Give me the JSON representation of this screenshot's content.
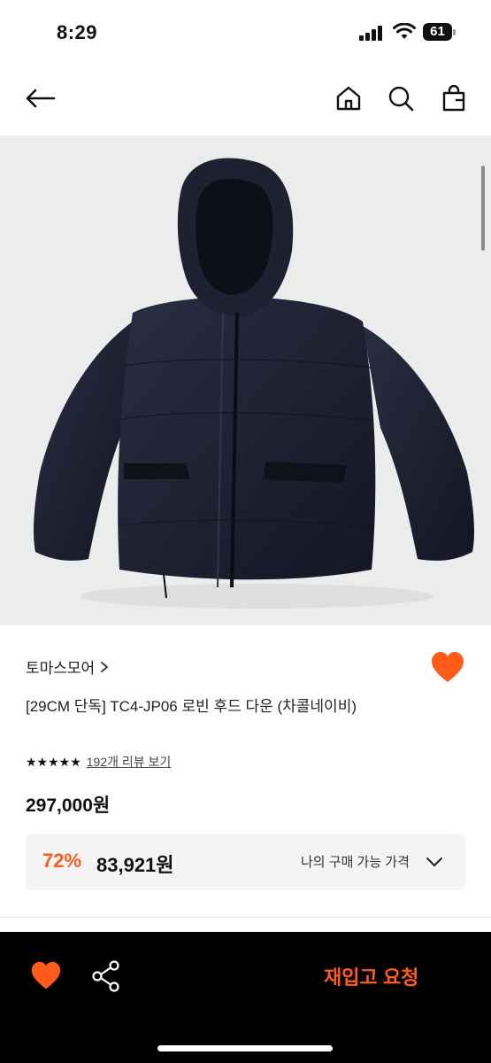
{
  "status_bar": {
    "time": "8:29",
    "battery": "61",
    "icons": [
      "signal-icon",
      "wifi-icon",
      "battery-icon"
    ]
  },
  "nav": {
    "icons": [
      "back-arrow-icon",
      "home-icon",
      "search-icon",
      "shopping-bag-icon"
    ]
  },
  "product": {
    "image": "navy-hooded-puffer-jacket",
    "brand": "토마스모어",
    "title": "[29CM 단독] TC4-JP06 로빈 후드 다운 (차콜네이비)",
    "stars": "★★★★★",
    "rating_value": 5,
    "reviews_link": "192개 리뷰 보기",
    "price": "297,000원"
  },
  "discount": {
    "rate": "72%",
    "price": "83,921원",
    "label": "나의 구매 가능 가격"
  },
  "bottom_bar": {
    "restock_label": "재입고 요청",
    "icons": [
      "heart-icon",
      "share-icon"
    ]
  },
  "colors": {
    "accent": "#ff5a1a",
    "bottom_bar_bg": "#000000",
    "image_bg": "#ececec",
    "jacket": "#1c1f2e"
  }
}
